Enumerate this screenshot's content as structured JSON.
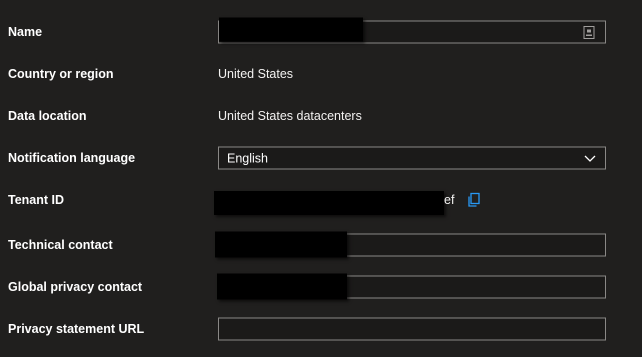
{
  "form": {
    "name": {
      "label": "Name",
      "value": "",
      "icon": "card-icon"
    },
    "country": {
      "label": "Country or region",
      "value": "United States"
    },
    "data_location": {
      "label": "Data location",
      "value": "United States datacenters"
    },
    "notification_language": {
      "label": "Notification language",
      "selected": "English",
      "icon": "chevron-down-icon"
    },
    "tenant_id": {
      "label": "Tenant ID",
      "visible_suffix": "ef",
      "copy_icon": "copy-icon"
    },
    "technical_contact": {
      "label": "Technical contact",
      "value": ""
    },
    "global_privacy_contact": {
      "label": "Global privacy contact",
      "value": ""
    },
    "privacy_statement_url": {
      "label": "Privacy statement URL",
      "value": ""
    }
  },
  "colors": {
    "background": "#201f1e",
    "field_border": "#8a8886",
    "accent": "#2899f5",
    "redaction": "#000000"
  }
}
